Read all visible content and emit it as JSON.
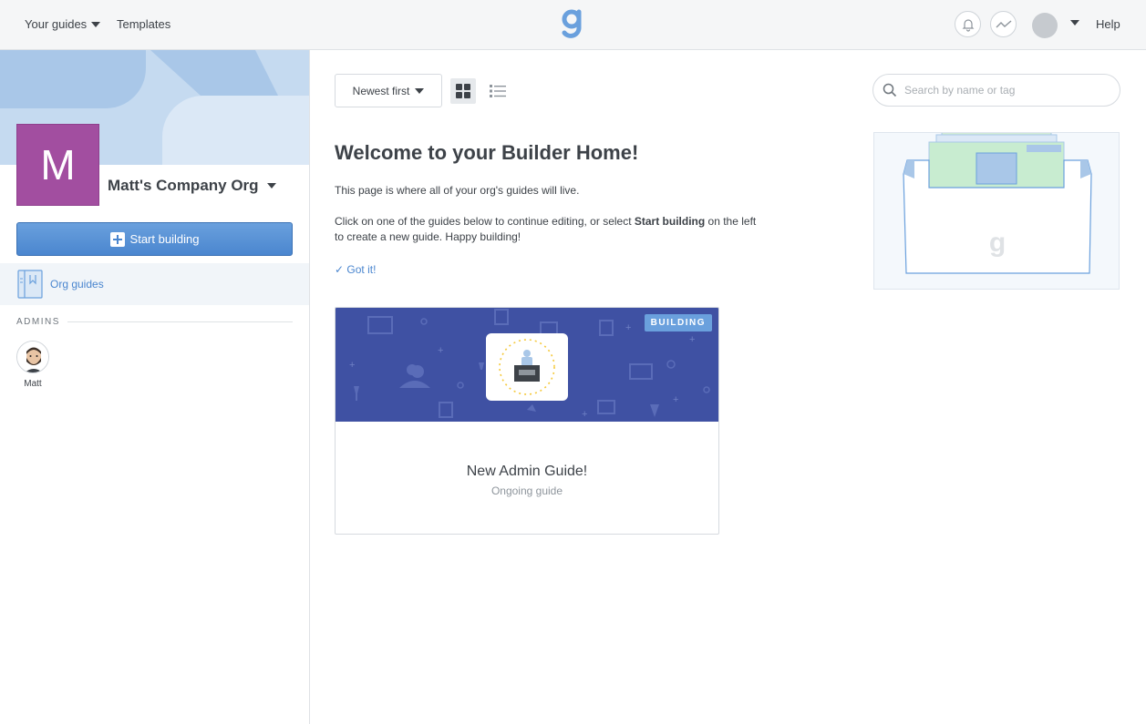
{
  "topbar": {
    "your_guides": "Your guides",
    "templates": "Templates",
    "help": "Help",
    "logo_icon": "guidebook-g-icon",
    "notification_icon": "bell-icon",
    "activity_icon": "activity-icon"
  },
  "sidebar": {
    "org_initial": "M",
    "org_name": "Matt's Company Org",
    "start_building": "Start building",
    "org_guides": "Org guides",
    "admins_heading": "ADMINS",
    "admins": [
      {
        "name": "Matt"
      }
    ]
  },
  "main": {
    "sort_label": "Newest first",
    "search_placeholder": "Search by name or tag",
    "welcome_title": "Welcome to your Builder Home!",
    "welcome_line1": "This page is where all of your org's guides will live.",
    "welcome_line2_before": "Click on one of the guides below to continue editing, or select ",
    "welcome_line2_bold": "Start building",
    "welcome_line2_after": " on the left to create a new guide. Happy building!",
    "got_it": "Got it!"
  },
  "guides": [
    {
      "title": "New Admin Guide!",
      "subtitle": "Ongoing guide",
      "status": "BUILDING"
    }
  ],
  "colors": {
    "accent": "#4a86cf",
    "org_color": "#a24ea0",
    "card_hero": "#3f51a3"
  }
}
